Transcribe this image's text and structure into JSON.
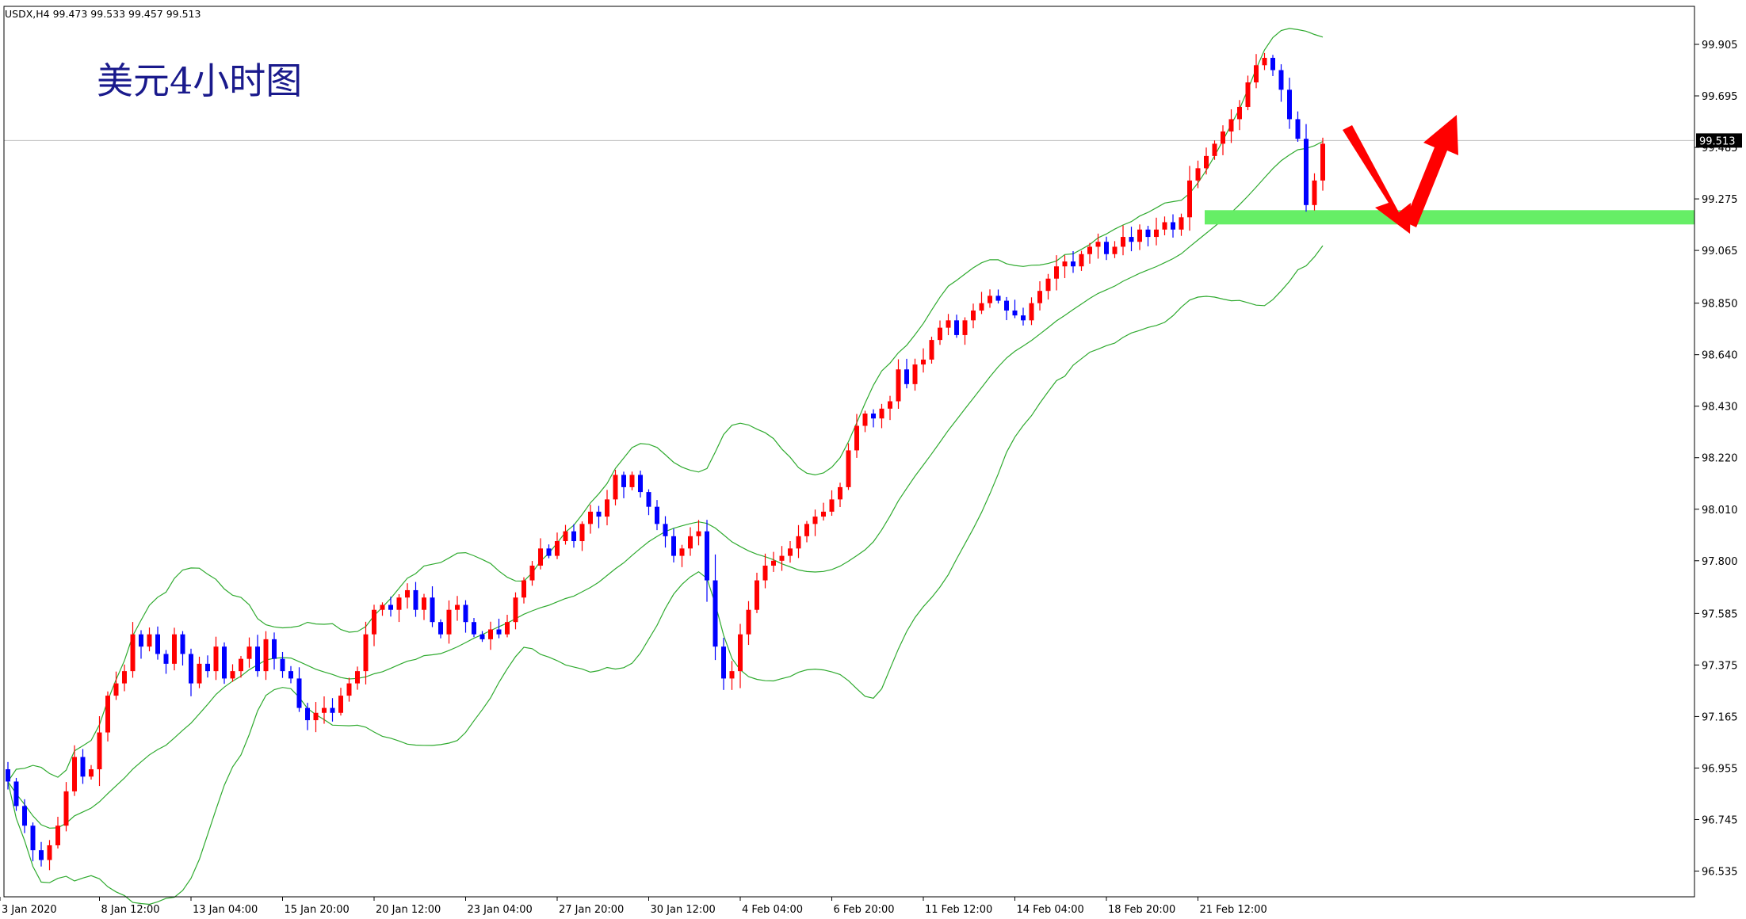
{
  "header": {
    "symbol_info": "USDX,H4  99.473 99.533 99.457 99.513"
  },
  "chart_title": "美元4小时图",
  "colors": {
    "bull": "#ff0000",
    "bear": "#0000ff",
    "band": "#2faa2f",
    "support": "#66ee66",
    "arrow": "#ff0000",
    "price_line": "#bfbfbf",
    "price_tag_bg": "#000000"
  },
  "chart_data": {
    "type": "candlestick",
    "title": "美元4小时图",
    "ylim": [
      96.43,
      100.06
    ],
    "y_ticks": [
      "99.905",
      "99.695",
      "99.485",
      "99.275",
      "99.065",
      "98.850",
      "98.640",
      "98.430",
      "98.220",
      "98.010",
      "97.800",
      "97.585",
      "97.375",
      "97.165",
      "96.955",
      "96.745",
      "96.535"
    ],
    "x_ticks": [
      "3 Jan 2020",
      "8 Jan 12:00",
      "13 Jan 04:00",
      "15 Jan 20:00",
      "20 Jan 12:00",
      "23 Jan 04:00",
      "27 Jan 20:00",
      "30 Jan 12:00",
      "4 Feb 04:00",
      "6 Feb 20:00",
      "11 Feb 12:00",
      "14 Feb 04:00",
      "18 Feb 20:00",
      "21 Feb 12:00"
    ],
    "current_price": "99.513",
    "support_level": 99.2,
    "closes": [
      96.9,
      96.8,
      96.72,
      96.62,
      96.58,
      96.64,
      96.72,
      96.86,
      97.0,
      96.92,
      96.95,
      97.1,
      97.25,
      97.3,
      97.35,
      97.5,
      97.45,
      97.5,
      97.42,
      97.38,
      97.5,
      97.42,
      97.3,
      97.38,
      97.35,
      97.45,
      97.32,
      97.35,
      97.4,
      97.45,
      97.35,
      97.48,
      97.4,
      97.35,
      97.32,
      97.2,
      97.15,
      97.18,
      97.2,
      97.18,
      97.25,
      97.3,
      97.35,
      97.5,
      97.6,
      97.62,
      97.6,
      97.65,
      97.68,
      97.6,
      97.65,
      97.55,
      97.5,
      97.6,
      97.62,
      97.55,
      97.5,
      97.48,
      97.52,
      97.5,
      97.55,
      97.65,
      97.72,
      97.78,
      97.85,
      97.82,
      97.88,
      97.92,
      97.88,
      97.95,
      98.0,
      97.98,
      98.05,
      98.15,
      98.1,
      98.15,
      98.08,
      98.02,
      97.95,
      97.9,
      97.82,
      97.85,
      97.9,
      97.92,
      97.72,
      97.45,
      97.32,
      97.35,
      97.5,
      97.6,
      97.72,
      97.78,
      97.8,
      97.82,
      97.85,
      97.9,
      97.95,
      97.98,
      98.0,
      98.05,
      98.1,
      98.25,
      98.35,
      98.4,
      98.38,
      98.42,
      98.45,
      98.58,
      98.52,
      98.6,
      98.62,
      98.7,
      98.75,
      98.78,
      98.72,
      98.78,
      98.82,
      98.85,
      98.88,
      98.86,
      98.82,
      98.8,
      98.78,
      98.85,
      98.9,
      98.95,
      99.0,
      99.02,
      99.0,
      99.05,
      99.08,
      99.1,
      99.05,
      99.08,
      99.12,
      99.1,
      99.15,
      99.12,
      99.15,
      99.18,
      99.15,
      99.2,
      99.35,
      99.4,
      99.45,
      99.5,
      99.55,
      99.6,
      99.65,
      99.75,
      99.82,
      99.85,
      99.8,
      99.72,
      99.6,
      99.52,
      99.25,
      99.35,
      99.5
    ]
  }
}
